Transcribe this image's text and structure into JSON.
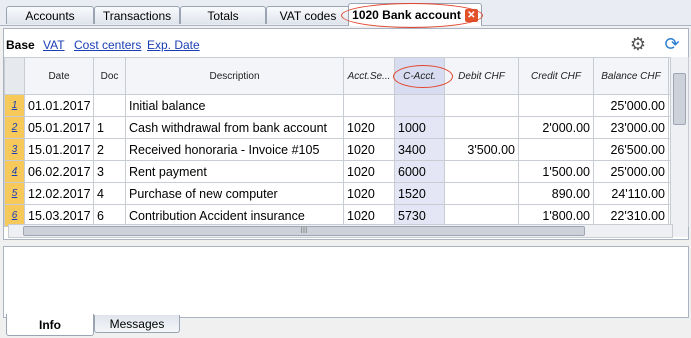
{
  "top_tabs": [
    {
      "label": "Accounts"
    },
    {
      "label": "Transactions"
    },
    {
      "label": "Totals"
    },
    {
      "label": "VAT codes"
    },
    {
      "label": "1020 Bank account"
    }
  ],
  "sub_tabs": {
    "base": "Base",
    "vat": "VAT",
    "cost_centers": "Cost centers",
    "exp_date": "Exp. Date"
  },
  "columns": {
    "date": "Date",
    "doc": "Doc",
    "description": "Description",
    "acct_se": "Acct.Se...",
    "c_acct": "C-Acct.",
    "debit": "Debit CHF",
    "credit": "Credit CHF",
    "balance": "Balance CHF"
  },
  "rows": [
    {
      "n": "1",
      "date": "01.01.2017",
      "doc": "",
      "desc": "Initial balance",
      "acct": "",
      "cacct": "",
      "debit": "",
      "credit": "",
      "balance": "25'000.00"
    },
    {
      "n": "2",
      "date": "05.01.2017",
      "doc": "1",
      "desc": "Cash withdrawal from bank account",
      "acct": "1020",
      "cacct": "1000",
      "debit": "",
      "credit": "2'000.00",
      "balance": "23'000.00"
    },
    {
      "n": "3",
      "date": "15.01.2017",
      "doc": "2",
      "desc": "Received honoraria - Invoice #105",
      "acct": "1020",
      "cacct": "3400",
      "debit": "3'500.00",
      "credit": "",
      "balance": "26'500.00"
    },
    {
      "n": "4",
      "date": "06.02.2017",
      "doc": "3",
      "desc": "Rent payment",
      "acct": "1020",
      "cacct": "6000",
      "debit": "",
      "credit": "1'500.00",
      "balance": "25'000.00"
    },
    {
      "n": "5",
      "date": "12.02.2017",
      "doc": "4",
      "desc": "Purchase of new computer",
      "acct": "1020",
      "cacct": "1520",
      "debit": "",
      "credit": "890.00",
      "balance": "24'110.00"
    },
    {
      "n": "6",
      "date": "15.03.2017",
      "doc": "6",
      "desc": "Contribution Accident insurance",
      "acct": "1020",
      "cacct": "5730",
      "debit": "",
      "credit": "1'800.00",
      "balance": "22'310.00"
    }
  ],
  "scroll_mark": "III",
  "bottom_tabs": [
    {
      "label": "Info"
    },
    {
      "label": "Messages"
    }
  ],
  "icons": {
    "settings": "gear-icon",
    "refresh": "refresh-icon",
    "close": "close-icon"
  },
  "colors": {
    "accent_row_num": "#f7c95a",
    "highlight_ellipse": "#e0452c",
    "column_highlight": "#e4e6f5",
    "link": "#1a3fb5"
  }
}
